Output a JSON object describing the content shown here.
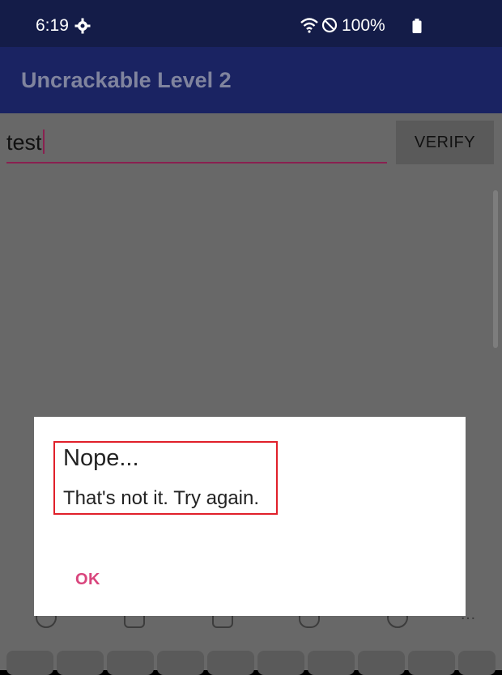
{
  "status_bar": {
    "time": "6:19",
    "battery": "100%",
    "icons": [
      "gear-icon",
      "wifi-icon",
      "do-not-disturb-icon",
      "battery-icon"
    ]
  },
  "app_bar": {
    "title": "Uncrackable Level 2"
  },
  "form": {
    "input_value": "test",
    "verify_label": "VERIFY"
  },
  "dialog": {
    "title": "Nope...",
    "message": "That's not it. Try again.",
    "ok_label": "OK"
  },
  "colors": {
    "status_bar": "#141c48",
    "app_bar": "#1a2362",
    "accent": "#d9457d",
    "highlight_box": "#e0202a"
  }
}
